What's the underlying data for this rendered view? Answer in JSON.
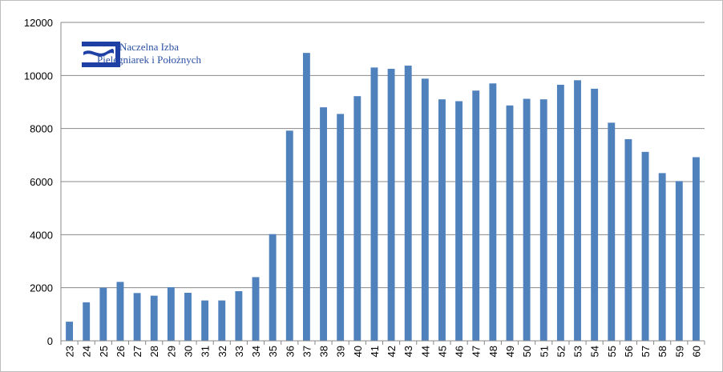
{
  "logo": {
    "name": "logo-naczelna-izba",
    "line1": "Naczelna Izba",
    "line2": "Pielęgniarek i Położnych",
    "color": "#1e3fa3"
  },
  "chart_data": {
    "type": "bar",
    "title": "",
    "xlabel": "",
    "ylabel": "",
    "categories": [
      "23",
      "24",
      "25",
      "26",
      "27",
      "28",
      "29",
      "30",
      "31",
      "32",
      "33",
      "34",
      "35",
      "36",
      "37",
      "38",
      "39",
      "40",
      "41",
      "42",
      "43",
      "44",
      "45",
      "46",
      "47",
      "48",
      "49",
      "50",
      "51",
      "52",
      "53",
      "54",
      "55",
      "56",
      "57",
      "58",
      "59",
      "60"
    ],
    "series": [
      {
        "values": [
          720,
          1450,
          2000,
          2220,
          1800,
          1700,
          2020,
          1810,
          1520,
          1520,
          1870,
          2400,
          4020,
          7920,
          10850,
          8800,
          8550,
          9220,
          10300,
          10250,
          10370,
          9880,
          9100,
          9030,
          9430,
          9700,
          8870,
          9120,
          9100,
          9650,
          9820,
          9500,
          8220,
          7600,
          7120,
          6320,
          6020,
          6920
        ],
        "color": "#4f81bd"
      }
    ],
    "ylim": [
      0,
      12000
    ],
    "yticks": [
      0,
      2000,
      4000,
      6000,
      8000,
      10000,
      12000
    ],
    "grid": true,
    "legend": "none"
  }
}
